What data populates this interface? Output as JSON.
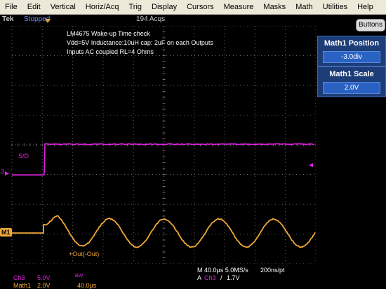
{
  "menu": [
    "File",
    "Edit",
    "Vertical",
    "Horiz/Acq",
    "Trig",
    "Display",
    "Cursors",
    "Measure",
    "Masks",
    "Math",
    "Utilities",
    "Help"
  ],
  "status": {
    "logo": "Tek",
    "run_state": "Stopped",
    "acquisitions": "194 Acqs"
  },
  "side_panel": {
    "buttons_label": "Buttons",
    "controls": [
      {
        "title": "Math1 Position",
        "value": "-3.0div"
      },
      {
        "title": "Math1 Scale",
        "value": "2.0V"
      }
    ]
  },
  "annotations": [
    "LM4675 Wake-up Time check",
    "Vdd=5V Inductance:10uH cap: 2uF on each Outputs",
    "Inputs AC coupled RL=4 Ohms"
  ],
  "waveform_labels": {
    "sd_label": "S/D",
    "ch3_marker": "3",
    "math_marker": "M1",
    "out_label": "+Out(-Out)"
  },
  "readouts": {
    "ch3_name": "Ch3",
    "ch3_scale": "5.0V",
    "math_name": "Math1",
    "math_scale": "2.0V",
    "bw_label": "BW",
    "math_time": "40.0µs",
    "horizontal": "M 40.0µs 5.0MS/s",
    "record": "200ns/pt",
    "trig_mode": "A",
    "trig_source": "Ch3",
    "trig_slope": "/",
    "trig_level": "1.7V"
  },
  "colors": {
    "ch3": "#e020e0",
    "math1": "#f0a838",
    "grid": "#6a6a6a",
    "panel": "#1c3d78",
    "status_blue": "#6b8ff0"
  }
}
